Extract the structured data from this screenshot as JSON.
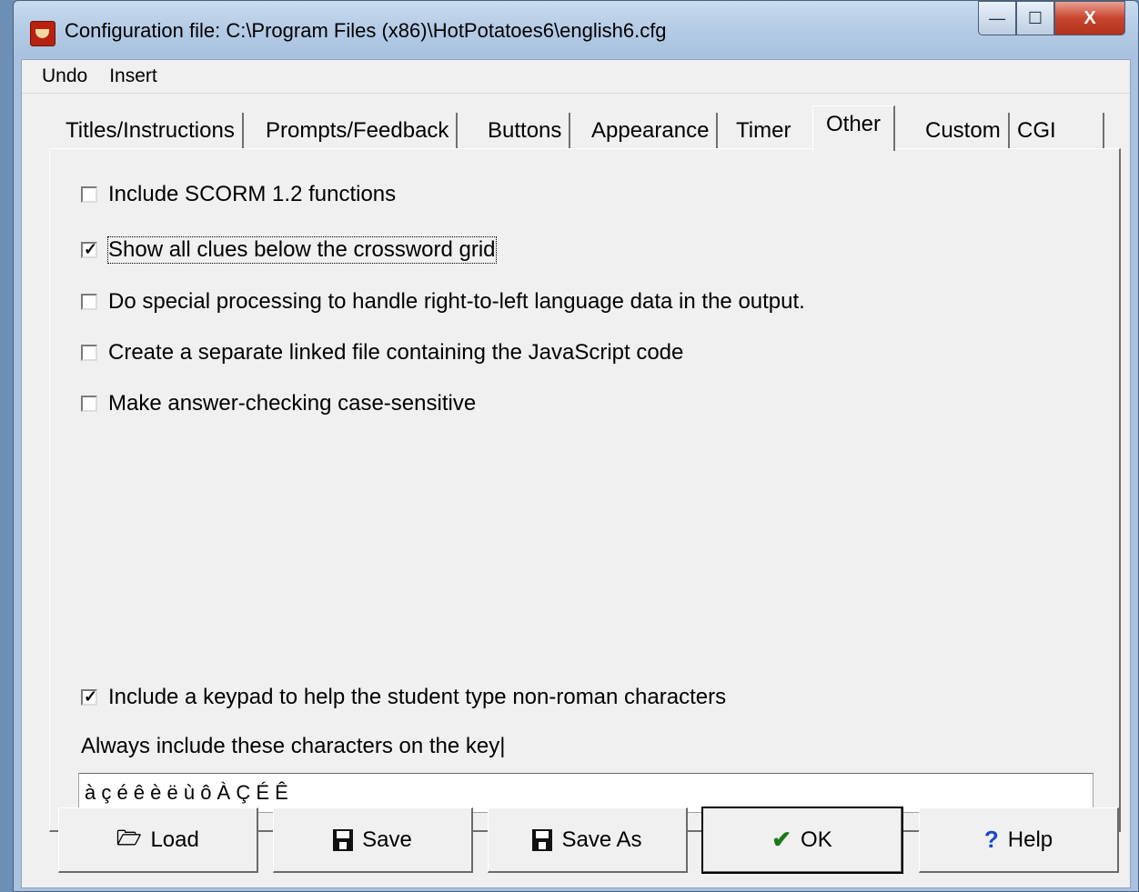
{
  "window": {
    "title": "Configuration file: C:\\Program Files (x86)\\HotPotatoes6\\english6.cfg",
    "caption_minimize": "—",
    "caption_maximize": "☐",
    "caption_close": "X"
  },
  "menu": {
    "undo": "Undo",
    "insert": "Insert"
  },
  "tabs": [
    {
      "label": "Titles/Instructions"
    },
    {
      "label": "Prompts/Feedback"
    },
    {
      "label": "Buttons"
    },
    {
      "label": "Appearance"
    },
    {
      "label": "Timer"
    },
    {
      "label": "Other"
    },
    {
      "label": "Custom"
    },
    {
      "label": "CGI"
    }
  ],
  "active_tab": "Other",
  "options": [
    {
      "label": "Include SCORM 1.2 functions",
      "checked": false
    },
    {
      "label": "Show all clues below the crossword grid",
      "checked": true
    },
    {
      "label": "Do special processing to handle right-to-left language data in the output.",
      "checked": false
    },
    {
      "label": "Create a separate linked file containing the JavaScript code",
      "checked": false
    },
    {
      "label": "Make answer-checking case-sensitive",
      "checked": false
    }
  ],
  "keypad": {
    "include_label": "Include a keypad to help the student type non-roman characters",
    "include_checked": true,
    "chars_label": "Always include these characters on the key|",
    "chars_value": "à ç é ê è ë ù ô À Ç É Ê"
  },
  "buttons": {
    "load": "Load",
    "save": "Save",
    "save_as": "Save As",
    "ok": "OK",
    "help": "Help"
  },
  "icons": {
    "load": "folder-icon",
    "save": "floppy-disk-icon",
    "save_as": "floppy-disk-question-icon",
    "ok": "checkmark-icon",
    "help": "question-mark-icon"
  },
  "colors": {
    "ok_check": "#1b7a1b",
    "help_question": "#1a48c8",
    "close_button": "#c8452e"
  }
}
